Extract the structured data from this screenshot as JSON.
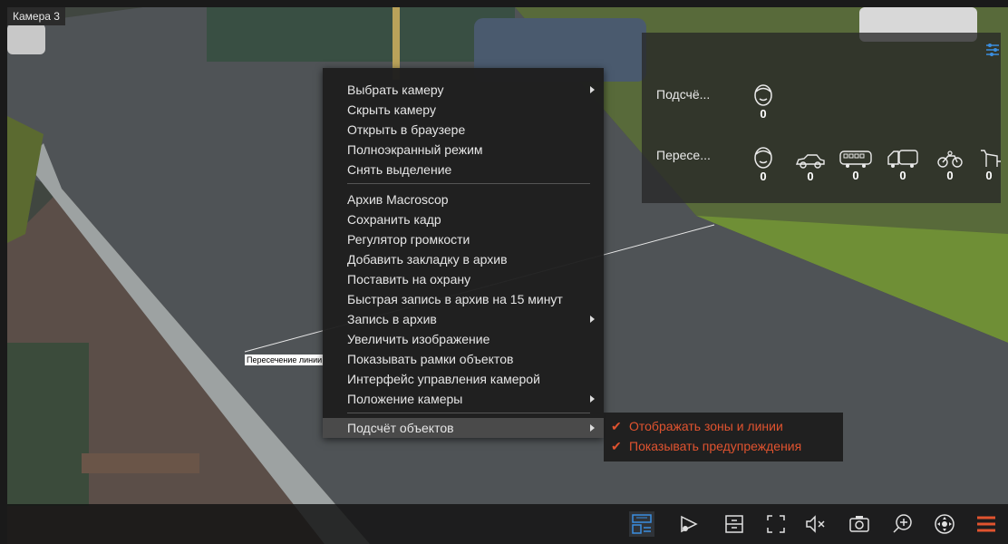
{
  "camera": {
    "title": "Камера 3"
  },
  "overlay": {
    "line_label": "Пересечение линии"
  },
  "context_menu": {
    "group1": [
      {
        "label": "Выбрать камеру",
        "submenu": true
      },
      {
        "label": "Скрыть камеру",
        "submenu": false
      },
      {
        "label": "Открыть в браузере",
        "submenu": false
      },
      {
        "label": "Полноэкранный режим",
        "submenu": false
      },
      {
        "label": "Снять выделение",
        "submenu": false
      }
    ],
    "group2": [
      {
        "label": "Архив Macroscop",
        "submenu": false
      },
      {
        "label": "Сохранить кадр",
        "submenu": false
      },
      {
        "label": "Регулятор громкости",
        "submenu": false
      },
      {
        "label": "Добавить закладку в архив",
        "submenu": false
      },
      {
        "label": "Поставить на охрану",
        "submenu": false
      },
      {
        "label": "Быстрая запись в архив на 15 минут",
        "submenu": false
      },
      {
        "label": "Запись в архив",
        "submenu": true
      },
      {
        "label": "Увеличить изображение",
        "submenu": false
      },
      {
        "label": "Показывать рамки объектов",
        "submenu": false
      },
      {
        "label": "Интерфейс управления камерой",
        "submenu": false
      },
      {
        "label": "Положение камеры",
        "submenu": true
      }
    ],
    "group3": [
      {
        "label": "Подсчёт объектов",
        "submenu": true
      }
    ]
  },
  "submenu": {
    "items": [
      {
        "label": "Отображать зоны и линии",
        "checked": true
      },
      {
        "label": "Показывать предупреждения",
        "checked": true
      }
    ],
    "color": "#e0532f"
  },
  "counter_panel": {
    "row1": {
      "label": "Подсчё...",
      "counts": {
        "person": "0"
      }
    },
    "row2": {
      "label": "Пересе...",
      "counts": {
        "person": "0",
        "car": "0",
        "bus": "0",
        "truck": "0",
        "motorcycle": "0",
        "animal": "0"
      }
    }
  },
  "toolbar": {
    "icons": [
      "object-counting-icon",
      "camera-settings-icon",
      "archive-icon",
      "fullscreen-icon",
      "mute-icon",
      "snapshot-icon",
      "zoom-in-icon",
      "ptz-icon",
      "menu-icon"
    ],
    "accent": "#e0532f"
  }
}
